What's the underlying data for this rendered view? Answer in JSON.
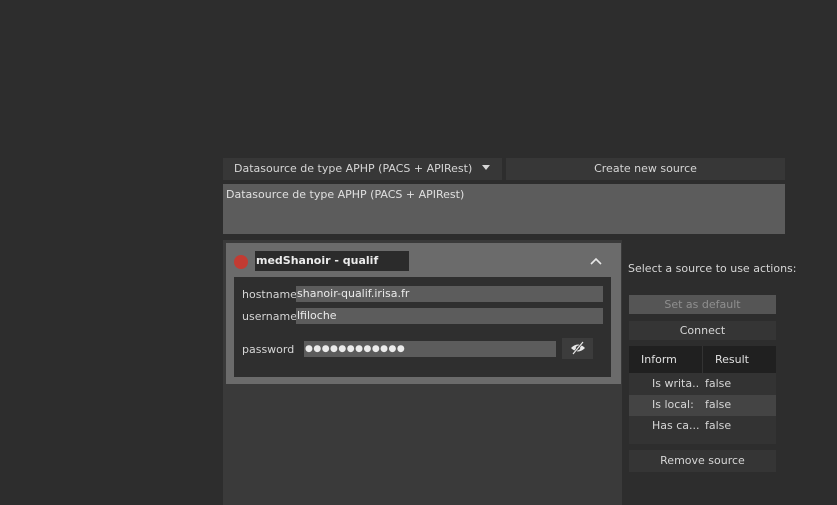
{
  "toolbar": {
    "type_selected": "Datasource de type APHP (PACS + APIRest)",
    "create_label": "Create new source"
  },
  "description": "Datasource de type APHP (PACS + APIRest)",
  "source": {
    "name": "medShanoir - qualif",
    "status_color": "#c23b32",
    "fields": {
      "hostname_label": "hostname",
      "hostname_value": "shanoir-qualif.irisa.fr",
      "username_label": "username",
      "username_value": "lfiloche",
      "password_label": "password",
      "password_mask": "●●●●●●●●●●●●"
    }
  },
  "actions": {
    "hint": "Select a source to use actions:",
    "set_default_label": "Set as default",
    "connect_label": "Connect",
    "remove_label": "Remove source",
    "table": {
      "headers": [
        "Inform",
        "Result"
      ],
      "rows": [
        {
          "info": "Is writa...",
          "result": "false"
        },
        {
          "info": "Is local:",
          "result": "false"
        },
        {
          "info": "Has ca...",
          "result": "false"
        }
      ]
    }
  }
}
